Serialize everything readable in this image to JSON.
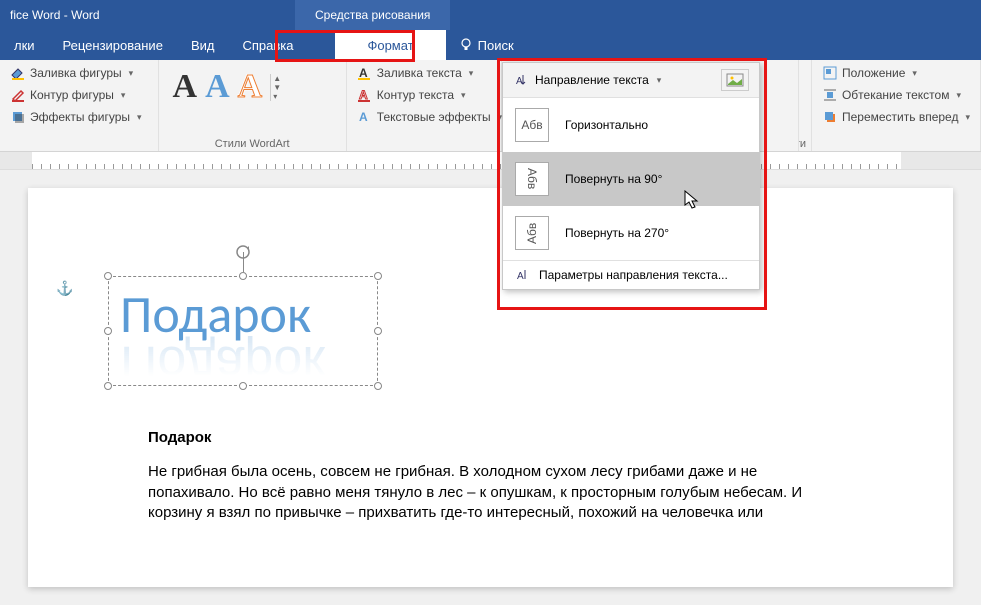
{
  "title": {
    "app": "fice Word  -  Word",
    "context_tab": "Средства рисования"
  },
  "tabs": {
    "t0": "лки",
    "t1": "Рецензирование",
    "t2": "Вид",
    "t3": "Справка",
    "t4": "Формат",
    "search": "Поиск"
  },
  "ribbon": {
    "shape_fill": "Заливка фигуры",
    "shape_outline": "Контур фигуры",
    "shape_effects": "Эффекты фигуры",
    "group_wa": "Стили WordArt",
    "text_fill": "Заливка текста",
    "text_outline": "Контур текста",
    "text_effects": "Текстовые эффекты",
    "text_direction": "Направление текста",
    "group_acc_partial": "ожности",
    "position": "Положение",
    "wrap": "Обтекание текстом",
    "bring_fwd": "Переместить вперед"
  },
  "dropdown": {
    "opt_h": "Горизонтально",
    "opt_90": "Повернуть на 90°",
    "opt_270": "Повернуть на 270°",
    "params": "Параметры направления текста...",
    "thumb": "Абв"
  },
  "wordart": {
    "text": "Подарок"
  },
  "document": {
    "heading": "Подарок",
    "para": "Не грибная была осень, совсем не грибная. В холодном сухом лесу грибами даже и не попахивало. Но всё равно меня тянуло в лес – к опушкам, к просторным голубым небесам. И корзину я взял по привычке – прихватить где-то интересный, похожий на человечка или"
  },
  "wa_samples": {
    "a": "А"
  }
}
